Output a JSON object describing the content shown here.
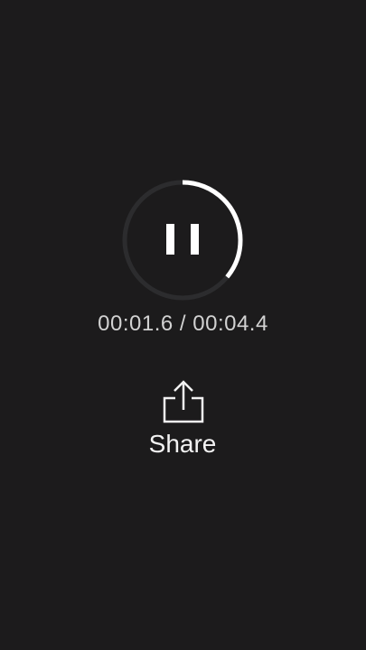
{
  "player": {
    "state": "playing",
    "control_icon": "pause-icon",
    "elapsed": "00:01.6",
    "separator": " / ",
    "total": "00:04.4",
    "progress_fraction": 0.36
  },
  "share": {
    "icon": "share-icon",
    "label": "Share"
  },
  "colors": {
    "background": "#1c1b1c",
    "ring_track": "#2c2c2e",
    "ring_progress": "#ffffff",
    "text_primary": "#f2f2f2",
    "text_secondary": "#d2d2d2"
  }
}
